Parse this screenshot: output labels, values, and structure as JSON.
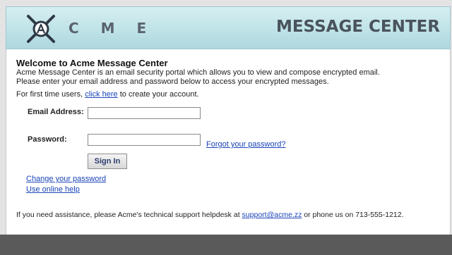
{
  "header": {
    "brand": "C M E",
    "title": "MESSAGE CENTER"
  },
  "welcome": {
    "title": "Welcome to Acme Message Center",
    "intro_line1": "Acme Message Center is an email security portal which allows you to view and compose encrypted email.",
    "intro_line2": "Please enter your email address and password below to access your encrypted messages.",
    "first_time_prefix": "For first time users,",
    "first_time_link": "click here",
    "first_time_suffix": "to create your account."
  },
  "form": {
    "email_label": "Email Address:",
    "email_value": "",
    "password_label": "Password:",
    "password_value": "",
    "forgot_link": "Forgot your password?",
    "signin_label": "Sign In"
  },
  "links": {
    "change_password": "Change your password",
    "online_help": "Use online help"
  },
  "footer": {
    "prefix": "If you need assistance, please Acme's technical support helpdesk at",
    "email": "support@acme.zz",
    "suffix": "or phone us on 713-555-1212."
  },
  "colors": {
    "header_bg": "#bfe3e8",
    "link": "#1a44b8",
    "bottom_bar": "#5a5a5a"
  },
  "icons": [
    "acme-logo-icon"
  ]
}
